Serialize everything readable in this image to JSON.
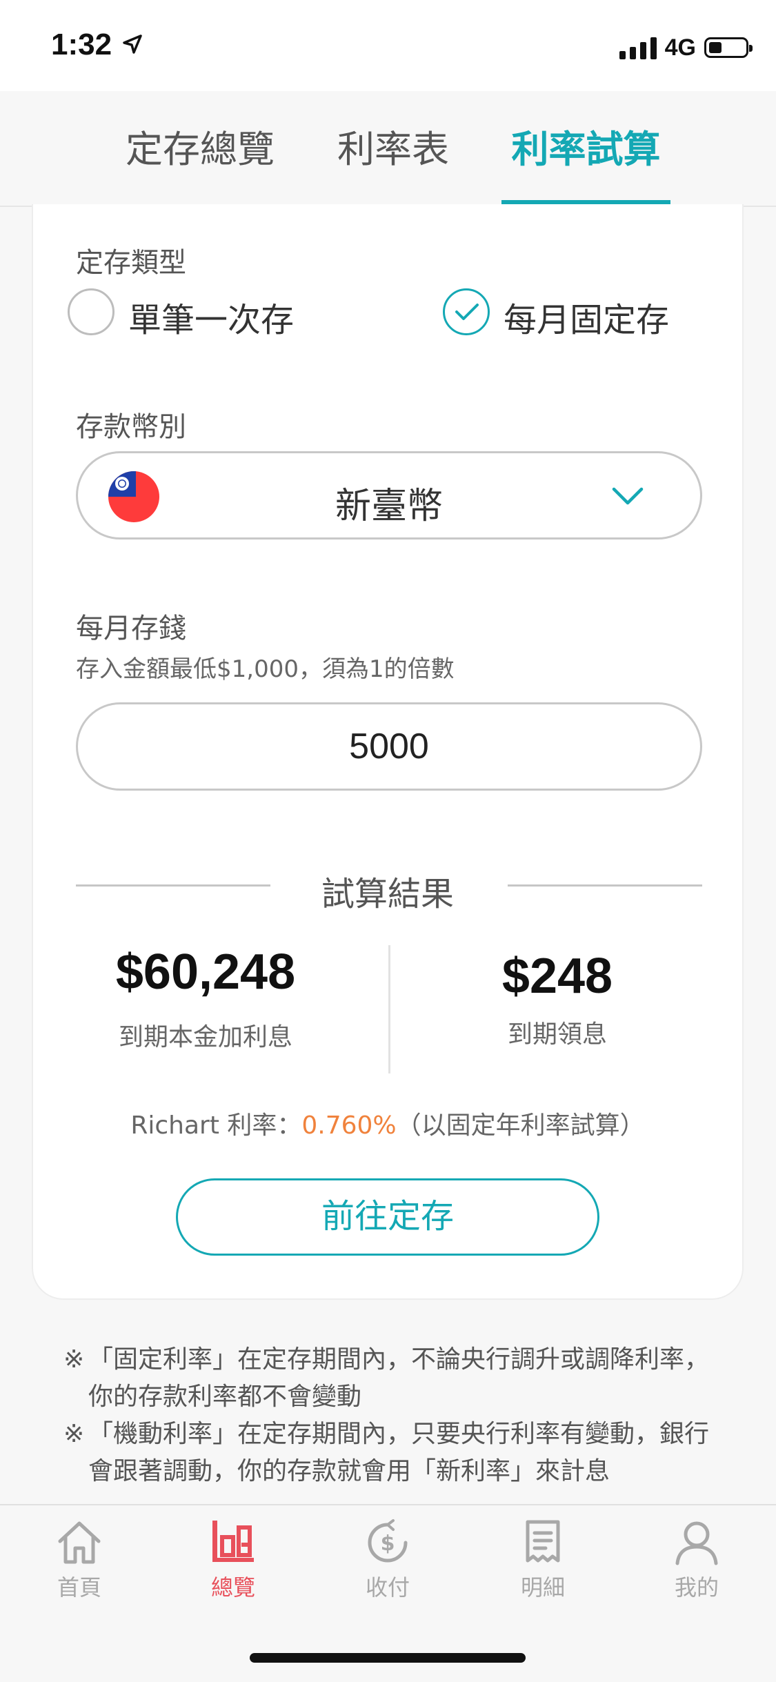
{
  "status_bar": {
    "time": "1:32",
    "network": "4G",
    "battery_percent": 25
  },
  "tabs": [
    {
      "label": "定存總覽",
      "active": false
    },
    {
      "label": "利率表",
      "active": false
    },
    {
      "label": "利率試算",
      "active": true
    }
  ],
  "form": {
    "deposit_type_label": "定存類型",
    "options": [
      {
        "label": "單筆一次存",
        "checked": false
      },
      {
        "label": "每月固定存",
        "checked": true
      }
    ],
    "currency_label": "存款幣別",
    "currency_value": "新臺幣",
    "monthly_label": "每月存錢",
    "monthly_hint": "存入金額最低$1,000，須為1的倍數",
    "monthly_value": "5000"
  },
  "result": {
    "title": "試算結果",
    "total_amount": "$60,248",
    "total_label": "到期本金加利息",
    "interest_amount": "$248",
    "interest_label": "到期領息",
    "rate_prefix": "Richart 利率：",
    "rate_value": "0.760%",
    "rate_suffix": "（以固定年利率試算）",
    "go_button": "前往定存"
  },
  "notes": [
    "「固定利率」在定存期間內，不論央行調升或調降利率，你的存款利率都不會變動",
    "「機動利率」在定存期間內，只要央行利率有變動，銀行會跟著調動，你的存款就會用「新利率」來計息"
  ],
  "note_mark": "※",
  "bottom_nav": [
    {
      "label": "首頁",
      "icon": "home-icon",
      "active": false
    },
    {
      "label": "總覽",
      "icon": "overview-chart-icon",
      "active": true
    },
    {
      "label": "收付",
      "icon": "dollar-coin-icon",
      "active": false
    },
    {
      "label": "明細",
      "icon": "receipt-icon",
      "active": false
    },
    {
      "label": "我的",
      "icon": "profile-icon",
      "active": false
    }
  ],
  "colors": {
    "accent": "#14a8b4",
    "rate": "#f0823c",
    "nav_active": "#e8505b"
  }
}
